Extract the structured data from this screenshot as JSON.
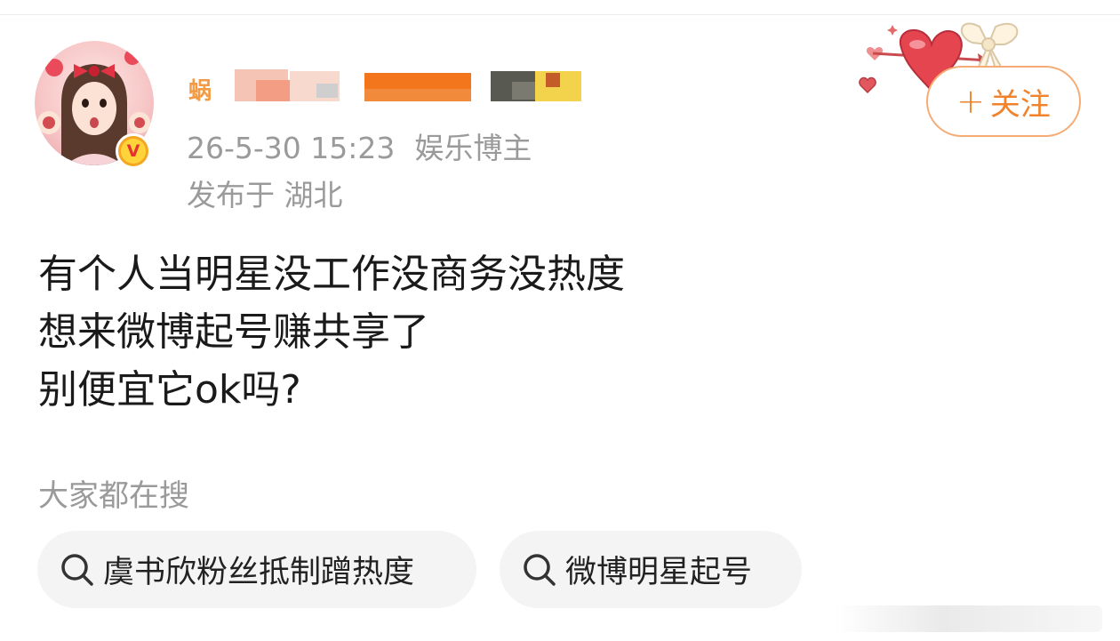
{
  "post": {
    "author": {
      "name_visible_fragment": "蜗",
      "verified_badge": "V",
      "timestamp": "26-5-30 15:23",
      "role": "娱乐博主",
      "location": "发布于 湖北"
    },
    "follow_button": {
      "plus": "+",
      "label": "关注"
    },
    "content_lines": [
      "有个人当明星没工作没商务没热度",
      "想来微博起号赚共享了",
      "别便宜它ok吗?"
    ]
  },
  "search": {
    "heading": "大家都在搜",
    "chips": [
      {
        "label": "虞书欣粉丝抵制蹭热度"
      },
      {
        "label": "微博明星起号"
      }
    ]
  },
  "colors": {
    "accent_orange": "#f0832b",
    "meta_gray": "#9a9a9a",
    "text_dark": "#1a1a1a",
    "chip_bg": "#f4f4f4"
  },
  "icons": [
    "avatar-image",
    "verified-badge-icon",
    "heart-arrow-decoration",
    "bow-decoration",
    "search-icon"
  ]
}
